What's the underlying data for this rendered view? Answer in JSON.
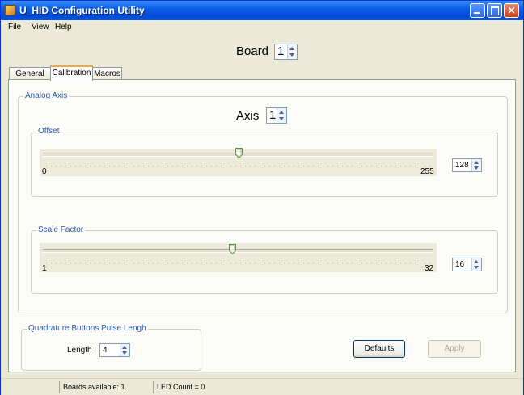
{
  "window": {
    "title": "U_HID Configuration Utility"
  },
  "menu": {
    "items": [
      "File",
      "View",
      "Help"
    ]
  },
  "board": {
    "label": "Board",
    "value": "1"
  },
  "tabs": [
    "General",
    "Calibration",
    "Macros"
  ],
  "active_tab": "Calibration",
  "analog_axis": {
    "group_label": "Analog Axis",
    "axis_label": "Axis",
    "axis_value": "1",
    "offset": {
      "group_label": "Offset",
      "min_label": "0",
      "max_label": "255",
      "value": "128",
      "slider_fraction": 0.502
    },
    "scale_factor": {
      "group_label": "Scale Factor",
      "min_label": "1",
      "max_label": "32",
      "value": "16",
      "slider_fraction": 0.484
    }
  },
  "quadrature": {
    "group_label": "Quadrature Buttons Pulse Lengh",
    "length_label": "Length",
    "length_value": "4"
  },
  "buttons": {
    "defaults": "Defaults",
    "apply": "Apply"
  },
  "status": {
    "boards": "Boards available: 1.",
    "leds": "LED Count = 0"
  }
}
